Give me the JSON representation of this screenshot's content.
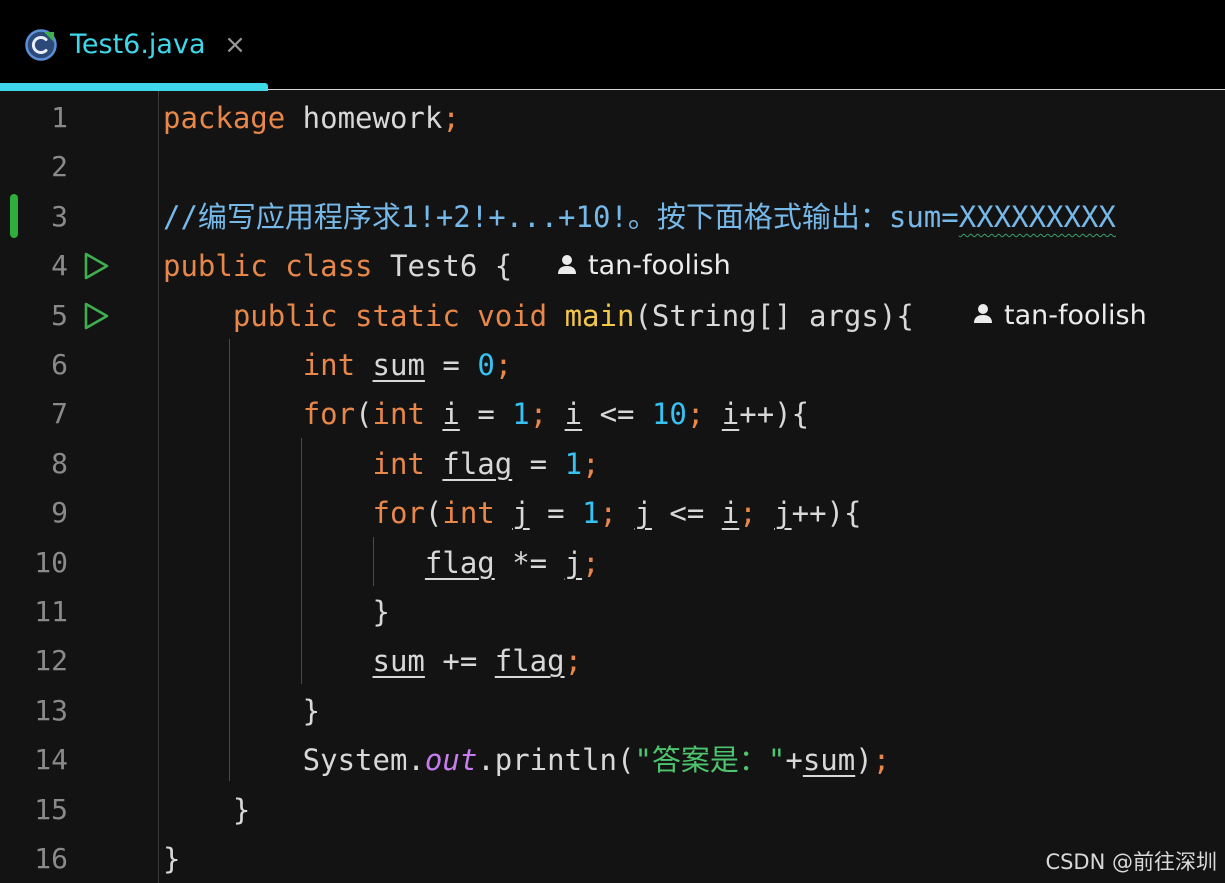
{
  "tab": {
    "title": "Test6.java",
    "close_glyph": "×",
    "icon": "java-class-icon"
  },
  "colors": {
    "keyword": "#e8874a",
    "number": "#36c2f2",
    "comment": "#76b8e8",
    "string": "#4dc46e",
    "method": "#f2c84b",
    "static_field": "#c77df0",
    "accent": "#3fd7ea",
    "change_marker": "#2fae3d",
    "run_icon": "#3fae4f"
  },
  "lines": [
    {
      "num": "1",
      "tokens": [
        {
          "t": "package",
          "c": "k"
        },
        {
          "t": " homework"
        },
        {
          "t": ";",
          "c": "k"
        }
      ]
    },
    {
      "num": "2",
      "tokens": []
    },
    {
      "num": "3",
      "tokens": [
        {
          "t": "//编写应用程序求1!+2!+...+10!。按下面格式输出：sum=",
          "c": "c"
        },
        {
          "t": "XXXXXXXXX",
          "c": "c wave"
        }
      ]
    },
    {
      "num": "4",
      "run": true,
      "author": "tan-foolish",
      "tokens": [
        {
          "t": "public class ",
          "c": "k"
        },
        {
          "t": "Test6 {"
        }
      ]
    },
    {
      "num": "5",
      "run": true,
      "author": "tan-foolish",
      "tokens": [
        {
          "t": "    "
        },
        {
          "t": "public static void ",
          "c": "k"
        },
        {
          "t": "main",
          "c": "m"
        },
        {
          "t": "(String[] args){"
        }
      ]
    },
    {
      "num": "6",
      "tokens": [
        {
          "t": "        "
        },
        {
          "t": "int ",
          "c": "k"
        },
        {
          "t": "sum",
          "c": "u"
        },
        {
          "t": " = "
        },
        {
          "t": "0",
          "c": "n"
        },
        {
          "t": ";",
          "c": "k"
        }
      ]
    },
    {
      "num": "7",
      "tokens": [
        {
          "t": "        "
        },
        {
          "t": "for",
          "c": "k"
        },
        {
          "t": "("
        },
        {
          "t": "int ",
          "c": "k"
        },
        {
          "t": "i",
          "c": "u"
        },
        {
          "t": " = "
        },
        {
          "t": "1",
          "c": "n"
        },
        {
          "t": "; ",
          "c": "k"
        },
        {
          "t": "i",
          "c": "u"
        },
        {
          "t": " <= "
        },
        {
          "t": "10",
          "c": "n"
        },
        {
          "t": "; ",
          "c": "k"
        },
        {
          "t": "i",
          "c": "u"
        },
        {
          "t": "++){"
        }
      ]
    },
    {
      "num": "8",
      "tokens": [
        {
          "t": "            "
        },
        {
          "t": "int ",
          "c": "k"
        },
        {
          "t": "flag",
          "c": "u"
        },
        {
          "t": " = "
        },
        {
          "t": "1",
          "c": "n"
        },
        {
          "t": ";",
          "c": "k"
        }
      ]
    },
    {
      "num": "9",
      "tokens": [
        {
          "t": "            "
        },
        {
          "t": "for",
          "c": "k"
        },
        {
          "t": "("
        },
        {
          "t": "int ",
          "c": "k"
        },
        {
          "t": "j",
          "c": "u"
        },
        {
          "t": " = "
        },
        {
          "t": "1",
          "c": "n"
        },
        {
          "t": "; ",
          "c": "k"
        },
        {
          "t": "j",
          "c": "u"
        },
        {
          "t": " <= "
        },
        {
          "t": "i",
          "c": "u"
        },
        {
          "t": "; ",
          "c": "k"
        },
        {
          "t": "j",
          "c": "u"
        },
        {
          "t": "++){"
        }
      ]
    },
    {
      "num": "10",
      "tokens": [
        {
          "t": "               "
        },
        {
          "t": "flag",
          "c": "u"
        },
        {
          "t": " *= "
        },
        {
          "t": "j",
          "c": "u"
        },
        {
          "t": ";",
          "c": "k"
        }
      ]
    },
    {
      "num": "11",
      "tokens": [
        {
          "t": "            }"
        }
      ]
    },
    {
      "num": "12",
      "tokens": [
        {
          "t": "            "
        },
        {
          "t": "sum",
          "c": "u"
        },
        {
          "t": " += "
        },
        {
          "t": "flag",
          "c": "u"
        },
        {
          "t": ";",
          "c": "k"
        }
      ]
    },
    {
      "num": "13",
      "tokens": [
        {
          "t": "        }"
        }
      ]
    },
    {
      "num": "14",
      "tokens": [
        {
          "t": "        System."
        },
        {
          "t": "out",
          "c": "o"
        },
        {
          "t": ".println("
        },
        {
          "t": "\"答案是：\"",
          "c": "s"
        },
        {
          "t": "+"
        },
        {
          "t": "sum",
          "c": "u"
        },
        {
          "t": ")"
        },
        {
          "t": ";",
          "c": "k"
        }
      ]
    },
    {
      "num": "15",
      "tokens": [
        {
          "t": "    }"
        }
      ]
    },
    {
      "num": "16",
      "tokens": [
        {
          "t": "}"
        }
      ]
    }
  ],
  "watermark": "CSDN @前往深圳"
}
